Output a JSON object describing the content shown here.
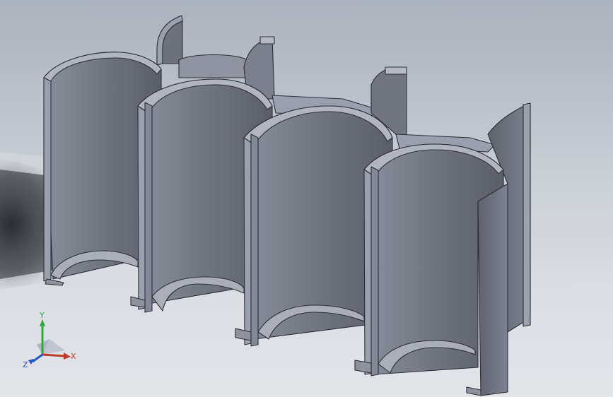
{
  "viewport": {
    "background_colors": [
      "#b8bec6",
      "#d7dbe0",
      "#e9ebee"
    ],
    "part_color_light": "#9ba1b0",
    "part_color_mid": "#7b8190",
    "part_color_dark": "#5b6070",
    "edge_color": "#2c2f38"
  },
  "triad": {
    "x_label": "X",
    "y_label": "Y",
    "z_label": "Z",
    "x_color": "#c0392b",
    "y_color": "#2eaa3a",
    "z_color": "#2456c8"
  }
}
